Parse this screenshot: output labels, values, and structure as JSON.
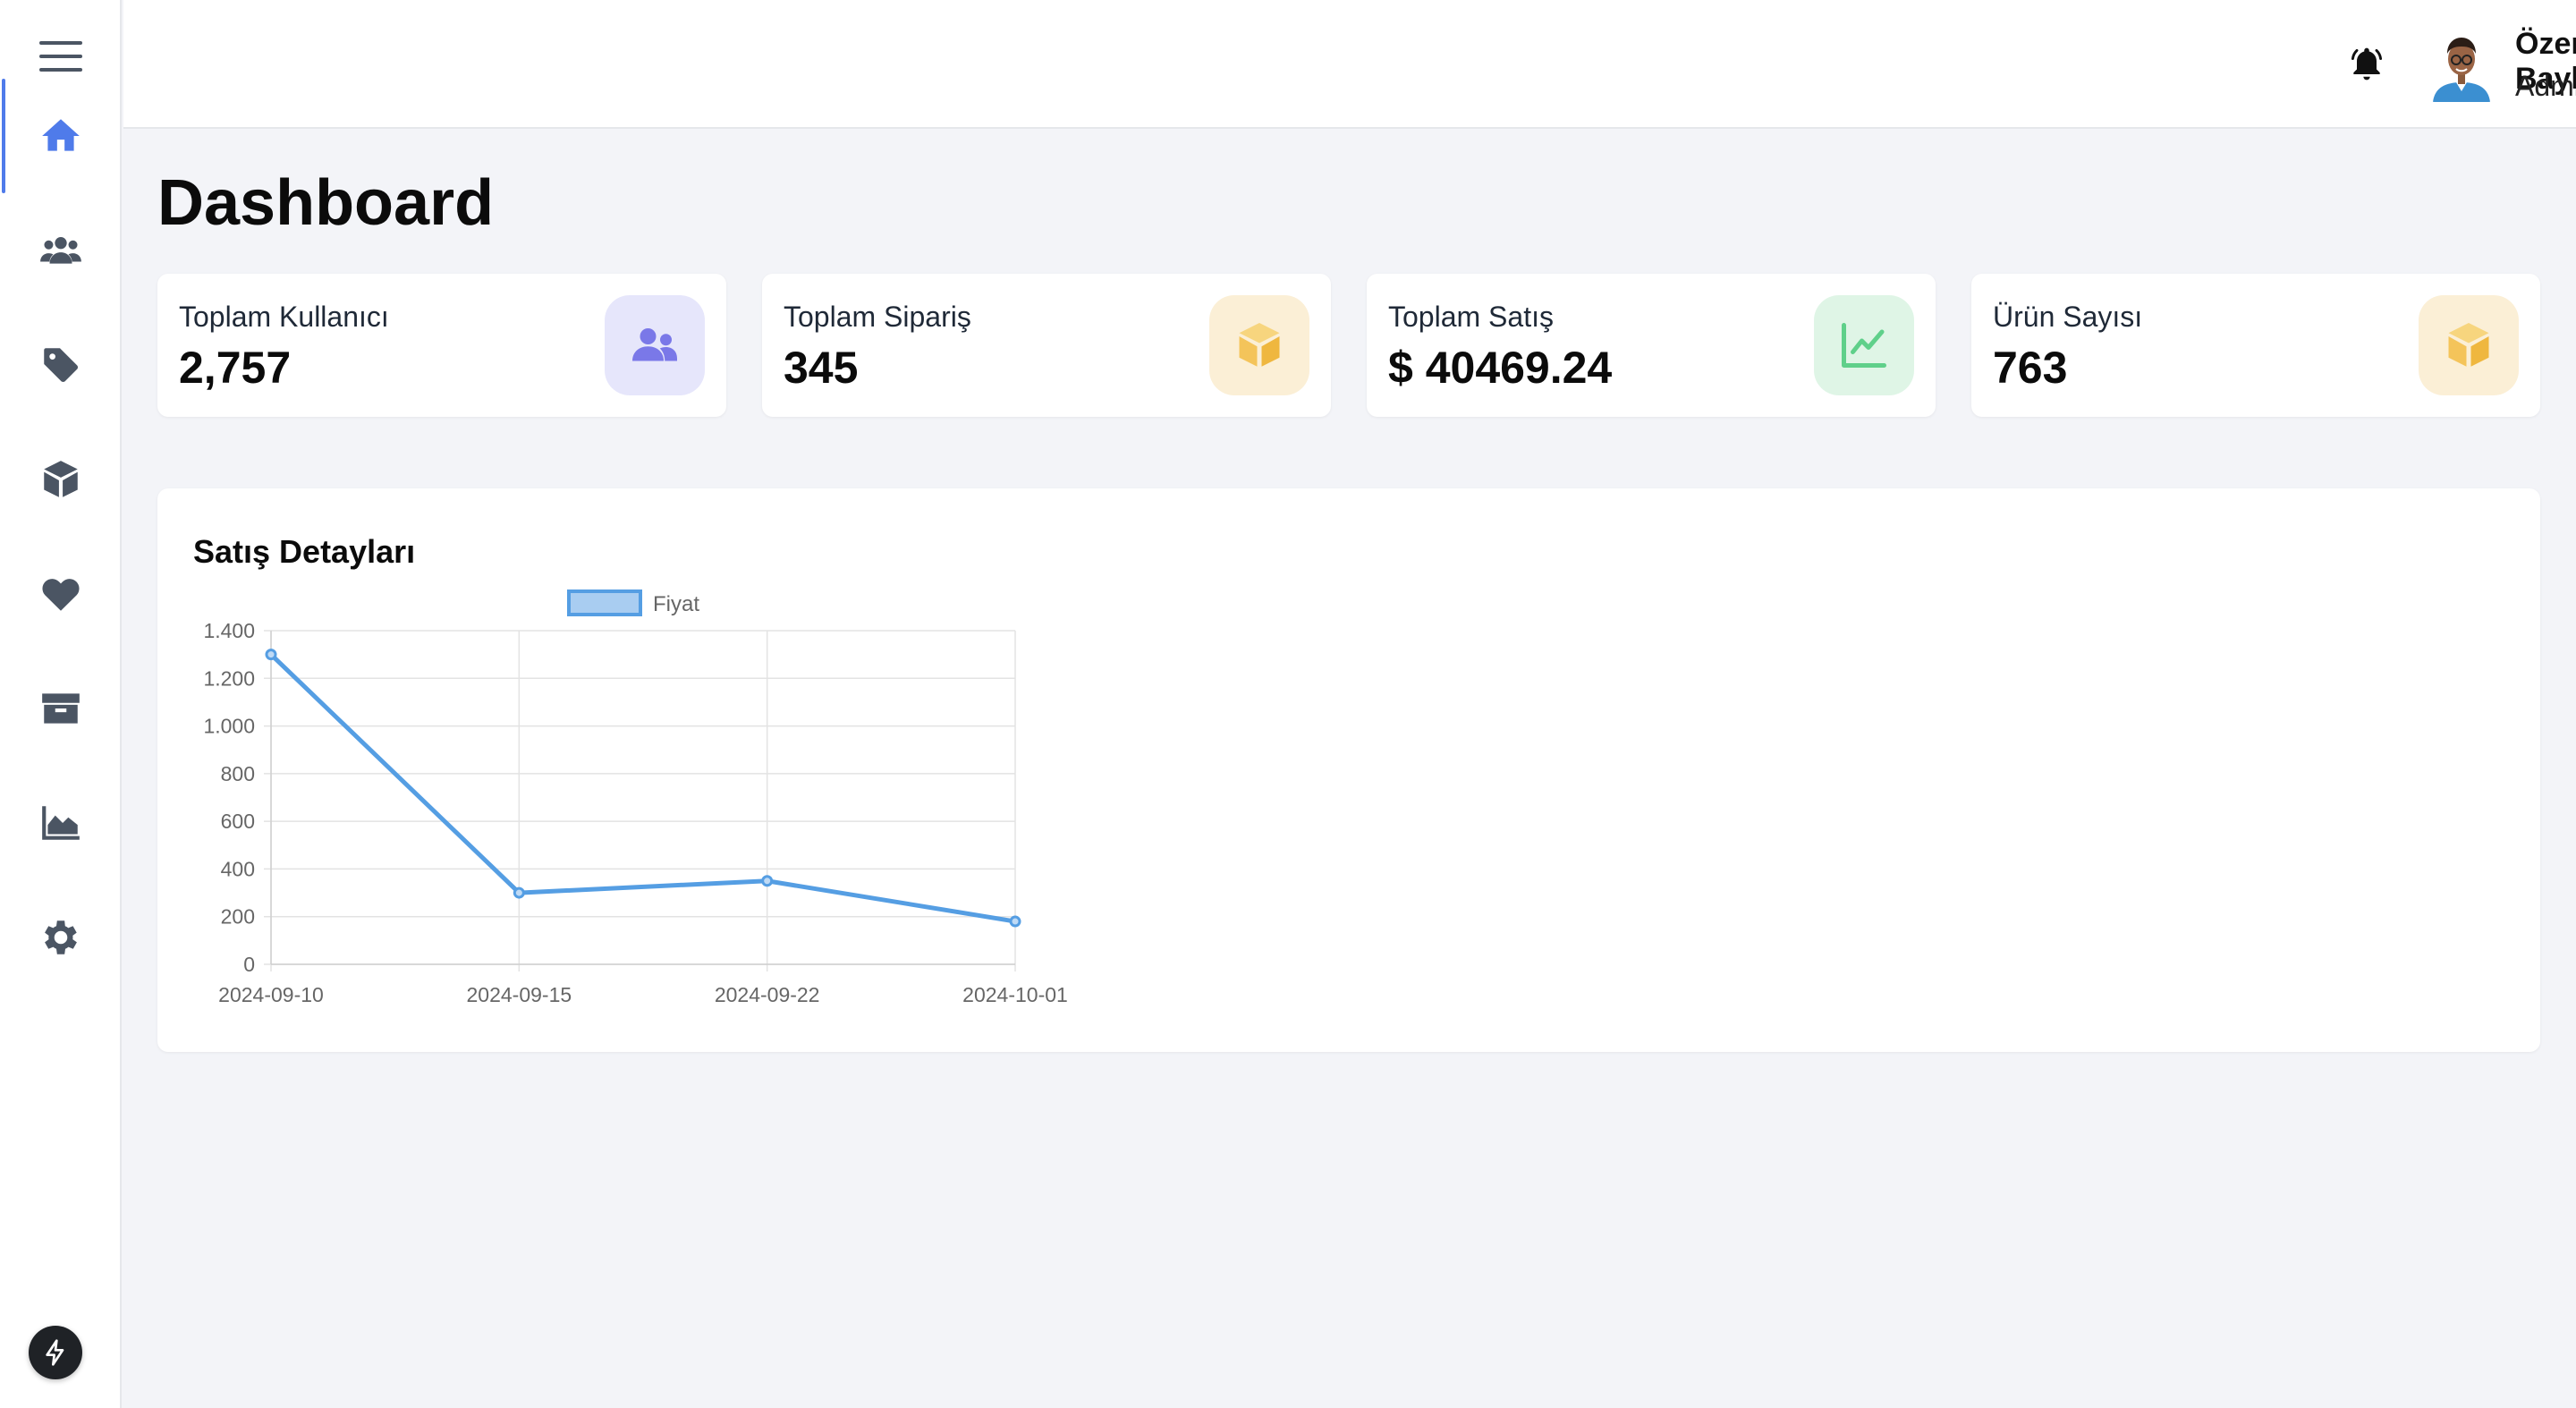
{
  "header": {
    "user_name": "Özer Baykal",
    "user_role": "Admin"
  },
  "sidebar": {
    "items": [
      {
        "icon": "home-icon",
        "active": true
      },
      {
        "icon": "users-icon"
      },
      {
        "icon": "tag-icon"
      },
      {
        "icon": "cube-icon"
      },
      {
        "icon": "heart-icon"
      },
      {
        "icon": "box-icon"
      },
      {
        "icon": "area-chart-icon"
      },
      {
        "icon": "gear-icon"
      }
    ]
  },
  "page": {
    "title": "Dashboard"
  },
  "stats": [
    {
      "label": "Toplam Kullanıcı",
      "value": "2,757",
      "icon": "users-icon",
      "icon_bg": "#e6e6fb",
      "icon_color": "#7a78e8"
    },
    {
      "label": "Toplam Sipariş",
      "value": "345",
      "icon": "cube-icon",
      "icon_bg": "#fbefd6",
      "icon_color": "#f4c45a"
    },
    {
      "label": "Toplam Satış",
      "value": "$ 40469.24",
      "icon": "line-chart-icon",
      "icon_bg": "#dff5e6",
      "icon_color": "#5fd08a"
    },
    {
      "label": "Ürün Sayısı",
      "value": "763",
      "icon": "cube-icon",
      "icon_bg": "#fbefd6",
      "icon_color": "#f4c45a"
    }
  ],
  "panel": {
    "title": "Satış Detayları"
  },
  "chart_data": {
    "type": "line",
    "title": "",
    "x": [
      "2024-09-10",
      "2024-09-15",
      "2024-09-22",
      "2024-10-01"
    ],
    "series": [
      {
        "name": "Fiyat",
        "values": [
          1300,
          300,
          350,
          180
        ],
        "color": "#559ee3"
      }
    ],
    "ylim": [
      0,
      1400
    ],
    "y_ticks": [
      "0",
      "200",
      "400",
      "600",
      "800",
      "1.000",
      "1.200",
      "1.400"
    ],
    "grid": true,
    "legend": "top"
  }
}
